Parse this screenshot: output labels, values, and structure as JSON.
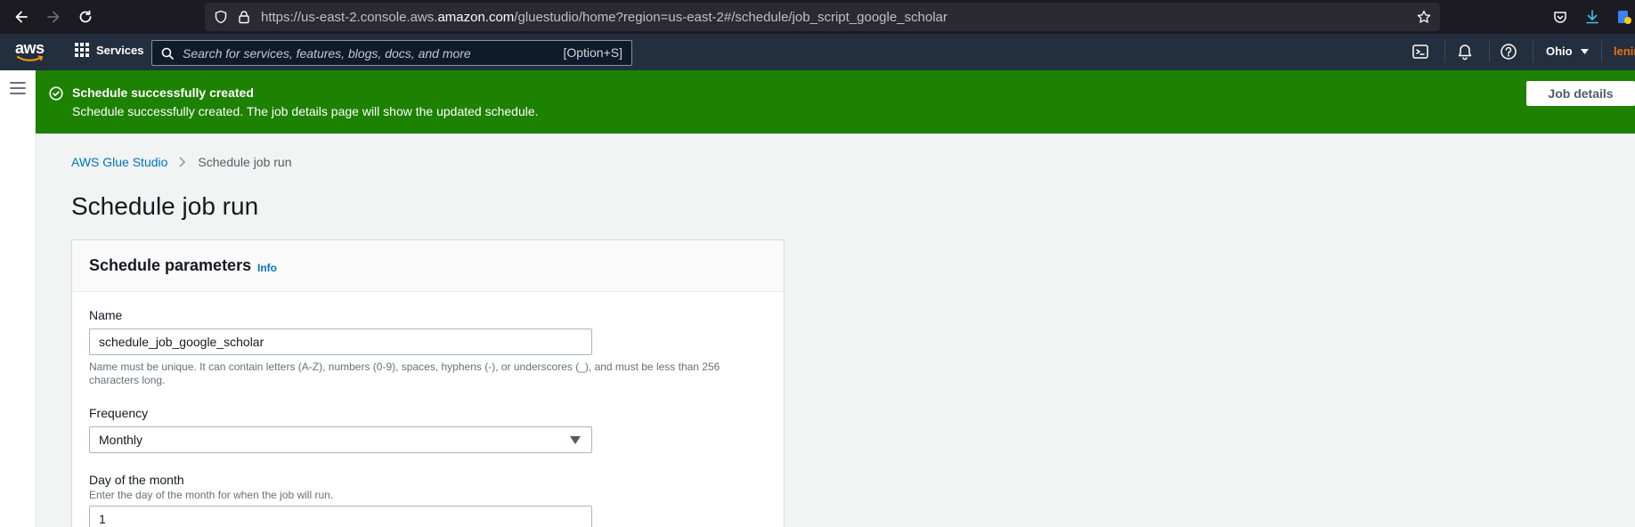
{
  "browser": {
    "url_prefix": "https://us-east-2.console.aws.",
    "url_domain": "amazon.com",
    "url_path": "/gluestudio/home?region=us-east-2#/schedule/job_script_google_scholar"
  },
  "nav": {
    "logo": "aws",
    "services_label": "Services",
    "search_placeholder": "Search for services, features, blogs, docs, and more",
    "search_shortcut": "[Option+S]",
    "region": "Ohio",
    "user": "lenin"
  },
  "flash": {
    "title": "Schedule successfully created",
    "message": "Schedule successfully created. The job details page will show the updated schedule.",
    "button": "Job details",
    "color": "#1d8102"
  },
  "breadcrumb": {
    "root": "AWS Glue Studio",
    "current": "Schedule job run"
  },
  "page": {
    "title": "Schedule job run"
  },
  "form": {
    "header": "Schedule parameters",
    "info": "Info",
    "name_label": "Name",
    "name_value": "schedule_job_google_scholar",
    "name_hint": "Name must be unique. It can contain letters (A-Z), numbers (0-9), spaces, hyphens (-), or underscores (_), and must be less than 256 characters long.",
    "frequency_label": "Frequency",
    "frequency_value": "Monthly",
    "day_label": "Day of the month",
    "day_hint": "Enter the day of the month for when the job will run.",
    "day_value": "1"
  }
}
